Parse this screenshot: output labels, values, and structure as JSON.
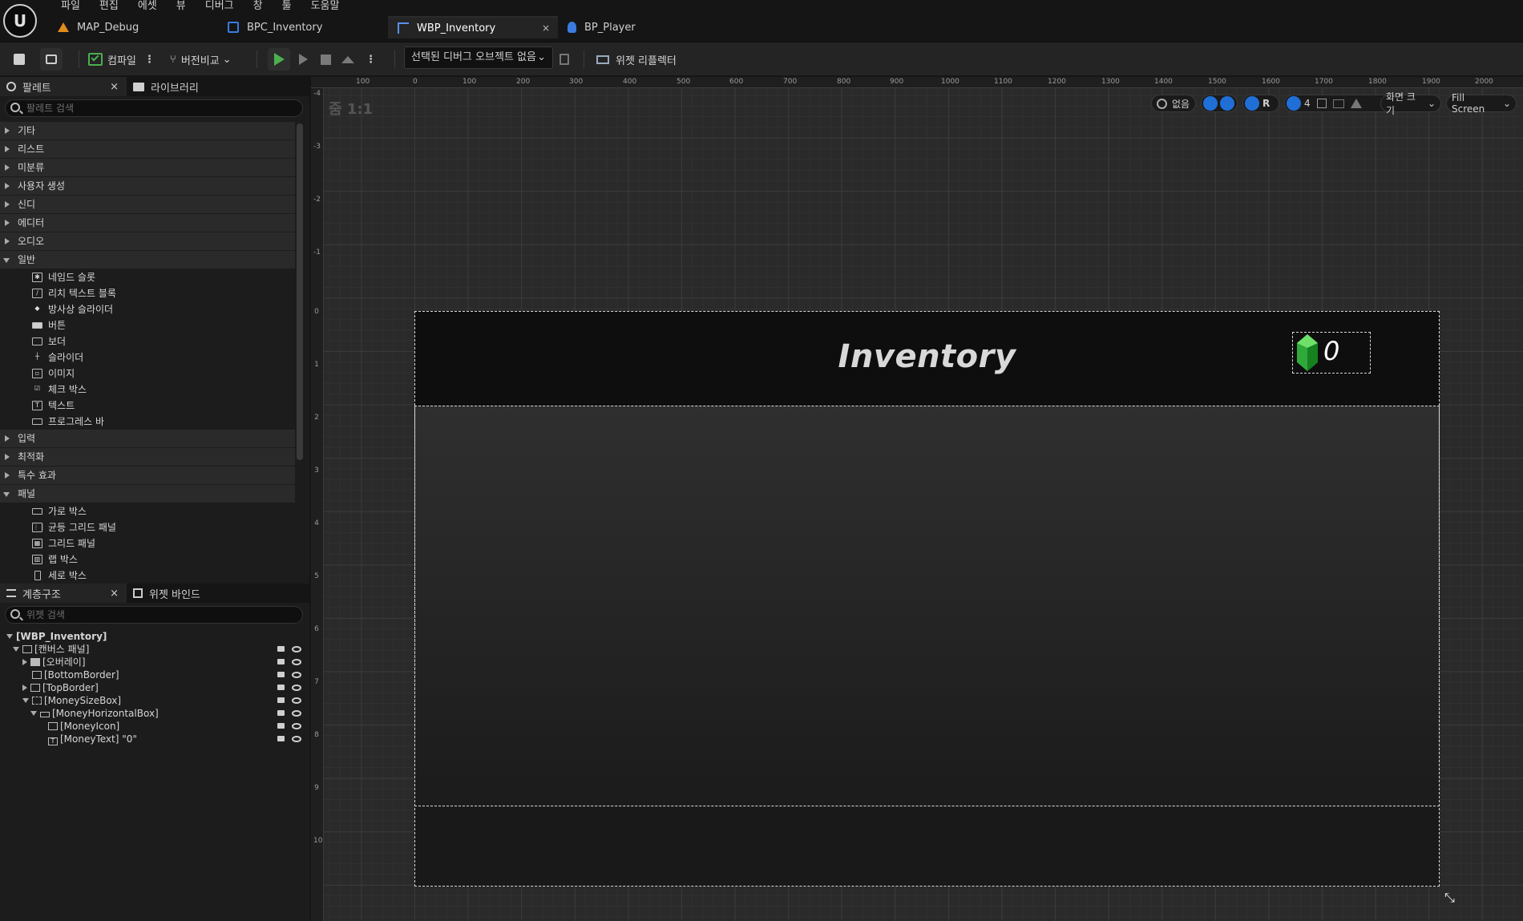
{
  "menu": [
    "파일",
    "편집",
    "에셋",
    "뷰",
    "디버그",
    "창",
    "툴",
    "도움말"
  ],
  "tabs": [
    {
      "label": "MAP_Debug"
    },
    {
      "label": "BPC_Inventory"
    },
    {
      "label": "WBP_Inventory",
      "close": "×"
    },
    {
      "label": "BP_Player"
    }
  ],
  "toolbar": {
    "compile_label": "컴파일",
    "diff_label": "버전비교",
    "debug_select": "선택된 디버그 오브젝트 없음",
    "widget_reflector": "위젯 리플렉터"
  },
  "palette": {
    "tab_label": "팔레트",
    "library_tab": "라이브러리",
    "close": "×",
    "search_placeholder": "팔레트 검색",
    "categories": [
      "기타",
      "리스트",
      "미분류",
      "사용자 생성",
      "신디",
      "에디터",
      "오디오",
      "일반",
      "입력",
      "최적화",
      "특수 효과",
      "패널"
    ],
    "general_items": [
      "네임드 슬롯",
      "리치 텍스트 블록",
      "방사상 슬라이더",
      "버튼",
      "보더",
      "슬라이더",
      "이미지",
      "체크 박스",
      "텍스트",
      "프로그레스 바"
    ],
    "panel_items": [
      "가로 박스",
      "균등 그리드 패널",
      "그리드 패널",
      "랩 박스",
      "세로 박스"
    ]
  },
  "hierarchy": {
    "tab_label": "계층구조",
    "bindings_tab": "위젯 바인드",
    "close": "×",
    "search_placeholder": "위젯 검색",
    "nodes": [
      "[WBP_Inventory]",
      "[캔버스 패널]",
      "[오버레이]",
      "[BottomBorder]",
      "[TopBorder]",
      "[MoneySizeBox]",
      "[MoneyHorizontalBox]",
      "[MoneyIcon]",
      "[MoneyText] \"0\""
    ]
  },
  "viewport": {
    "zoom": "줌 1:1",
    "localization": "없음",
    "grid_size": "4",
    "r_label": "R",
    "screen_size": "화면 크기",
    "fill_screen": "Fill Screen",
    "ruler_ticks": [
      "100",
      "0",
      "100",
      "200",
      "300",
      "400",
      "500",
      "600",
      "700",
      "800",
      "900",
      "1000",
      "1100",
      "1200",
      "1300",
      "1400",
      "1500",
      "1600",
      "1700",
      "1800",
      "1900",
      "2000"
    ],
    "ruler_left": [
      "-4",
      "-3",
      "-2",
      "-1",
      "0",
      "1",
      "2",
      "3",
      "4",
      "5",
      "6",
      "7",
      "8",
      "9",
      "10"
    ]
  },
  "canvas": {
    "title": "Inventory",
    "money": "0"
  },
  "colors": {
    "accent": "#1f6fd6",
    "gem": "#2faa3a",
    "play": "#4caf50"
  }
}
